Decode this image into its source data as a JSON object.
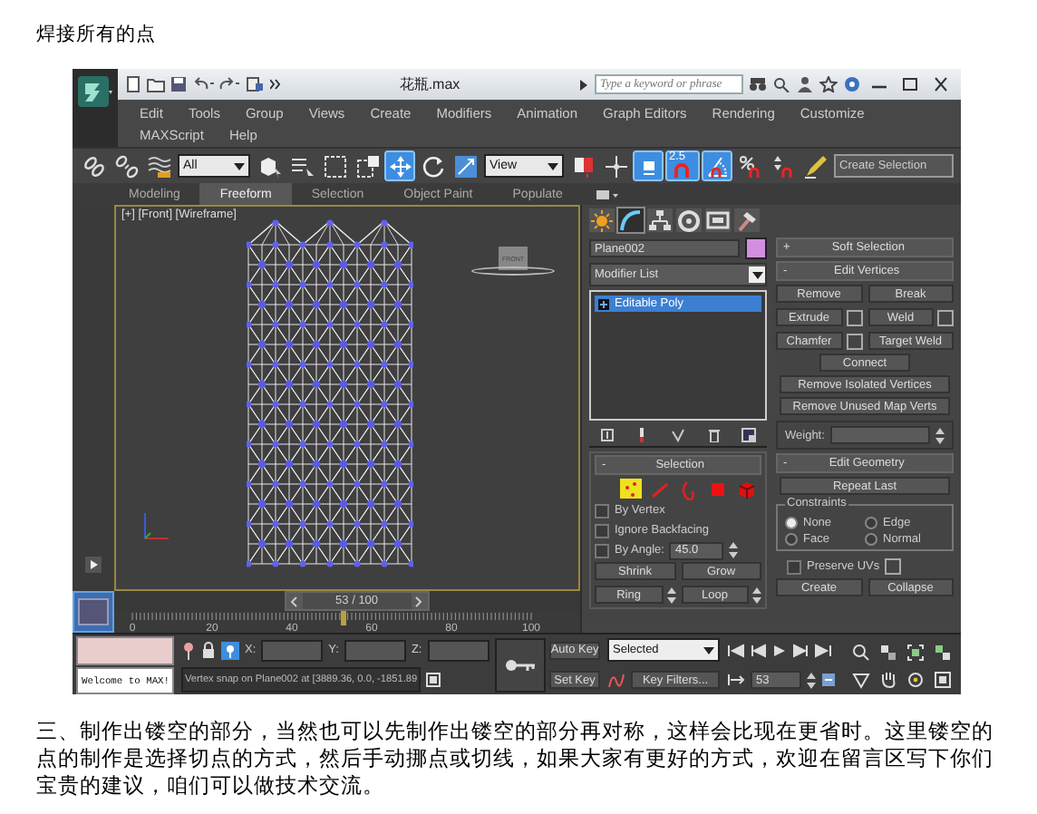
{
  "heading": "焊接所有的点",
  "app": {
    "title": "花瓶.max",
    "search": {
      "placeholder": "Type a keyword or phrase"
    },
    "menus": [
      [
        "Edit",
        "Tools",
        "Group",
        "Views",
        "Create",
        "Modifiers",
        "Animation",
        "Graph Editors",
        "Rendering",
        "Customize"
      ],
      [
        "MAXScript",
        "Help"
      ]
    ],
    "toolbar": [
      {
        "kind": "link",
        "active": false
      },
      {
        "kind": "unlink",
        "active": false
      },
      {
        "kind": "bind",
        "active": false
      },
      {
        "kind": "dropdown",
        "label": "All",
        "active": false
      },
      {
        "kind": "select",
        "active": false
      },
      {
        "kind": "select-by-name",
        "active": false
      },
      {
        "kind": "region",
        "active": false
      },
      {
        "kind": "window",
        "active": false
      },
      {
        "kind": "move",
        "active": true
      },
      {
        "kind": "rotate",
        "active": false
      },
      {
        "kind": "scale",
        "active": false
      },
      {
        "kind": "dropdown",
        "label": "View",
        "active": false
      },
      {
        "kind": "pivot",
        "active": false
      },
      {
        "kind": "manipulate",
        "active": false
      },
      {
        "kind": "keyboard",
        "active": true
      },
      {
        "kind": "snap",
        "label": "2.5",
        "active": true
      },
      {
        "kind": "angle-snap",
        "active": true
      },
      {
        "kind": "percent-snap",
        "active": false
      },
      {
        "kind": "spinner-snap",
        "active": false
      },
      {
        "kind": "edit-named",
        "active": false
      },
      {
        "kind": "named-set",
        "label": "Create Selection",
        "active": false
      }
    ],
    "ribbon_tabs": [
      {
        "label": "Modeling",
        "selected": false
      },
      {
        "label": "Freeform",
        "selected": true
      },
      {
        "label": "Selection",
        "selected": false
      },
      {
        "label": "Object Paint",
        "selected": false
      },
      {
        "label": "Populate",
        "selected": false
      }
    ],
    "viewport": {
      "label": "[+] [Front] [Wireframe]",
      "viewcube": "FRONT"
    },
    "timeline": {
      "label": "53 / 100",
      "level": 0.53,
      "ticks": [
        "0",
        "20",
        "40",
        "60",
        "80",
        "100"
      ]
    },
    "command_panel": {
      "tabs": [
        {
          "kind": "create",
          "selected": false
        },
        {
          "kind": "modify",
          "selected": true
        },
        {
          "kind": "hierarchy",
          "selected": false
        },
        {
          "kind": "motion",
          "selected": false
        },
        {
          "kind": "display",
          "selected": false
        },
        {
          "kind": "utilities",
          "selected": false
        }
      ],
      "object_name": "Plane002",
      "modifier_list": "Modifier List",
      "stack": [
        {
          "label": "Editable Poly",
          "selected": true
        }
      ],
      "selection": {
        "sign": "-",
        "title": "Selection",
        "levels": [
          {
            "kind": "vertex",
            "selected": true
          },
          {
            "kind": "edge",
            "selected": false
          },
          {
            "kind": "border",
            "selected": false
          },
          {
            "kind": "polygon",
            "selected": false
          },
          {
            "kind": "element",
            "selected": false
          }
        ],
        "options": [
          {
            "label": "By Vertex",
            "checked": false
          },
          {
            "label": "Ignore Backfacing",
            "checked": false
          },
          {
            "label": "By Angle:",
            "checked": false
          }
        ],
        "angle": "45.0",
        "buttons": [
          {
            "label": "Shrink",
            "spinner": false
          },
          {
            "label": "Grow",
            "spinner": false
          },
          {
            "label": "Ring",
            "spinner": true
          },
          {
            "label": "Loop",
            "spinner": true
          }
        ]
      },
      "soft_selection": {
        "sign": "+",
        "title": "Soft Selection"
      },
      "edit_vertices": {
        "sign": "-",
        "title": "Edit Vertices",
        "buttons": [
          {
            "label": "Remove",
            "settings": false
          },
          {
            "label": "Break",
            "settings": false
          },
          {
            "label": "Extrude",
            "settings": true
          },
          {
            "label": "Weld",
            "settings": true
          },
          {
            "label": "Chamfer",
            "settings": true
          },
          {
            "label": "Target Weld",
            "settings": false
          }
        ],
        "wide_buttons": [
          "Connect",
          "Remove Isolated Vertices",
          "Remove Unused Map Verts"
        ],
        "weight": "Weight:"
      },
      "edit_geometry": {
        "sign": "-",
        "title": "Edit Geometry",
        "repeat": "Repeat Last",
        "constraints_title": "Constraints",
        "constraints": [
          {
            "label": "None",
            "selected": true
          },
          {
            "label": "Edge",
            "selected": false
          },
          {
            "label": "Face",
            "selected": false
          },
          {
            "label": "Normal",
            "selected": false
          }
        ],
        "preserve_uvs": {
          "label": "Preserve UVs",
          "checked": false
        },
        "buttons": [
          "Create",
          "Collapse"
        ]
      }
    },
    "status": {
      "welcome": "Welcome to MAX!",
      "coords": [
        "X:",
        "Y:",
        "Z:"
      ],
      "message": "Vertex snap on Plane002 at [3889.36, 0.0, -1851.89",
      "auto_key": "Auto Key",
      "set_key": "Set Key",
      "key_mode": "Selected",
      "key_filters": "Key Filters...",
      "frame": "53"
    }
  },
  "paragraph": "三、制作出镂空的部分，当然也可以先制作出镂空的部分再对称，这样会比现在更省时。这里镂空的点的制作是选择切点的方式，然后手动挪点或切线，如果大家有更好的方式，欢迎在留言区写下你们宝贵的建议，咱们可以做技术交流。"
}
